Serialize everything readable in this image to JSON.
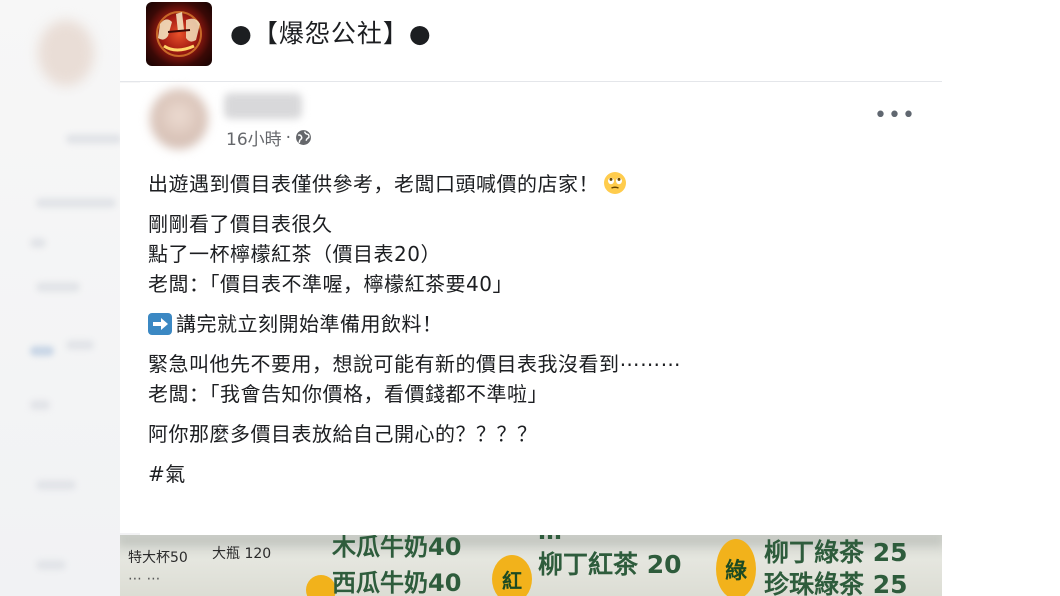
{
  "group": {
    "name": "●【爆怨公社】●",
    "logo_text": "爆怨公社"
  },
  "post": {
    "timestamp": "16小時",
    "separator": "·",
    "lines": [
      "出遊遇到價目表僅供參考，老闆口頭喊價的店家！",
      "剛剛看了價目表很久",
      "點了一杯檸檬紅茶（價目表20）",
      "老闆：「價目表不準喔，檸檬紅茶要40」",
      "講完就立刻開始準備用飲料！",
      "緊急叫他先不要用，想說可能有新的價目表我沒看到⋯⋯⋯",
      "老闆：「我會告知你價格，看價錢都不準啦」",
      "阿你那麼多價目表放給自己開心的？？？？",
      "#氣"
    ]
  },
  "photo": {
    "items": [
      "特大杯50",
      "大瓶 120",
      "木瓜牛奶40",
      "西瓜牛奶40",
      "紅",
      "柳丁紅茶 20",
      "綠",
      "柳丁綠茶 25",
      "珍珠綠茶 25"
    ]
  },
  "icons": {
    "globe": "globe-icon",
    "more": "more-options-icon",
    "emoji": "rolling-eyes-emoji-icon",
    "arrow": "right-arrow-emoji-icon"
  },
  "colors": {
    "text": "#1c1e21",
    "meta": "#65676b",
    "arrow_bg": "#3b88c3",
    "emoji_yellow": "#ffcc4d",
    "menu_green": "#2e5c3c",
    "badge_yellow": "#f2b21b"
  }
}
